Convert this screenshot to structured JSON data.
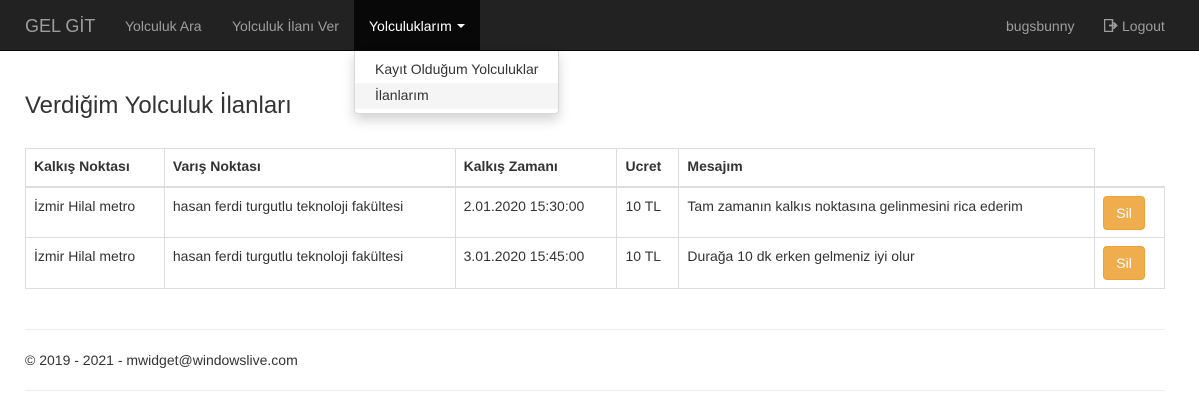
{
  "navbar": {
    "brand": "GEL GİT",
    "items": [
      {
        "label": "Yolculuk Ara"
      },
      {
        "label": "Yolculuk İlanı Ver"
      }
    ],
    "active_dropdown": {
      "label": "Yolculuklarım"
    },
    "user": "bugsbunny",
    "logout": "Logout"
  },
  "dropdown": {
    "items": [
      {
        "label": "Kayıt Olduğum Yolculuklar"
      },
      {
        "label": "İlanlarım"
      }
    ]
  },
  "page_title": "Verdiğim Yolculuk İlanları",
  "table": {
    "headers": [
      "Kalkış Noktası",
      "Varış Noktası",
      "Kalkış Zamanı",
      "Ucret",
      "Mesajım"
    ],
    "rows": [
      {
        "from": "İzmir Hilal metro",
        "to": "hasan ferdi turgutlu teknoloji fakültesi",
        "time": "2.01.2020 15:30:00",
        "price": "10 TL",
        "message": "Tam zamanın kalkıs noktasına gelinmesini rica ederim",
        "action": "Sil"
      },
      {
        "from": "İzmir Hilal metro",
        "to": "hasan ferdi turgutlu teknoloji fakültesi",
        "time": "3.01.2020 15:45:00",
        "price": "10 TL",
        "message": "Durağa 10 dk erken gelmeniz iyi olur",
        "action": "Sil"
      }
    ]
  },
  "footer": "© 2019 - 2021 - mwidget@windowslive.com",
  "colors": {
    "navbar": "#222222",
    "active_nav": "#080808",
    "warning_button": "#f0ad4e"
  }
}
